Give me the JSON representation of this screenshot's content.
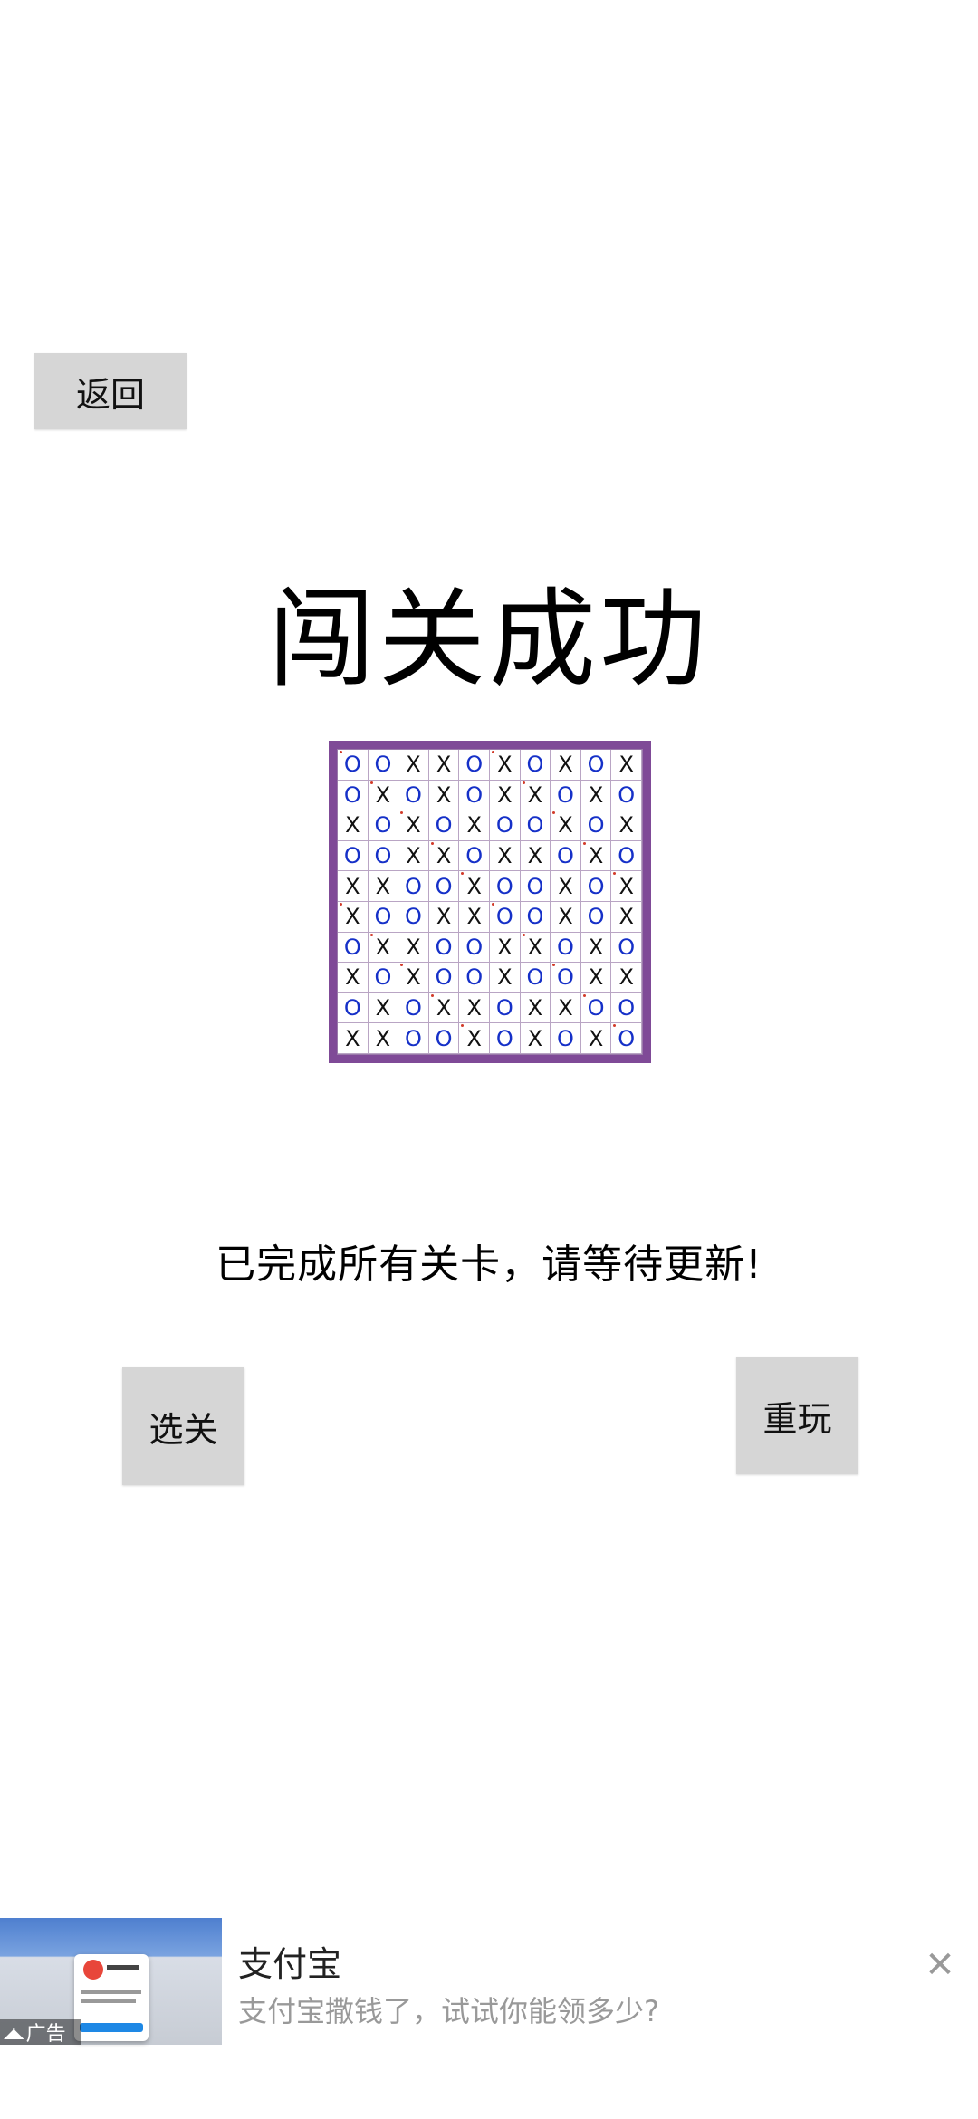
{
  "header": {
    "back_label": "返回"
  },
  "result": {
    "title": "闯关成功",
    "message": "已完成所有关卡，请等待更新!"
  },
  "actions": {
    "select_label": "选关",
    "replay_label": "重玩"
  },
  "colors": {
    "board_border": "#7f4a97",
    "o_color": "#1530c8",
    "x_color": "#111111",
    "button_bg": "#d6d6d6"
  },
  "board": {
    "rows": [
      [
        "O",
        "O",
        "X",
        "X",
        "O",
        "X",
        "O",
        "X",
        "O",
        "X"
      ],
      [
        "O",
        "X",
        "O",
        "X",
        "O",
        "X",
        "X",
        "O",
        "X",
        "O"
      ],
      [
        "X",
        "O",
        "X",
        "O",
        "X",
        "O",
        "O",
        "X",
        "O",
        "X"
      ],
      [
        "O",
        "O",
        "X",
        "X",
        "O",
        "X",
        "X",
        "O",
        "X",
        "O"
      ],
      [
        "X",
        "X",
        "O",
        "O",
        "X",
        "O",
        "O",
        "X",
        "O",
        "X"
      ],
      [
        "X",
        "O",
        "O",
        "X",
        "X",
        "O",
        "O",
        "X",
        "O",
        "X"
      ],
      [
        "O",
        "X",
        "X",
        "O",
        "O",
        "X",
        "X",
        "O",
        "X",
        "O"
      ],
      [
        "X",
        "O",
        "X",
        "O",
        "O",
        "X",
        "O",
        "O",
        "X",
        "X"
      ],
      [
        "O",
        "X",
        "O",
        "X",
        "X",
        "O",
        "X",
        "X",
        "O",
        "O"
      ],
      [
        "X",
        "X",
        "O",
        "O",
        "X",
        "O",
        "X",
        "O",
        "X",
        "O"
      ]
    ]
  },
  "ad": {
    "title": "支付宝",
    "subtitle": "支付宝撒钱了，试试你能领多少?",
    "label": "广告",
    "close_icon": "close-icon"
  }
}
